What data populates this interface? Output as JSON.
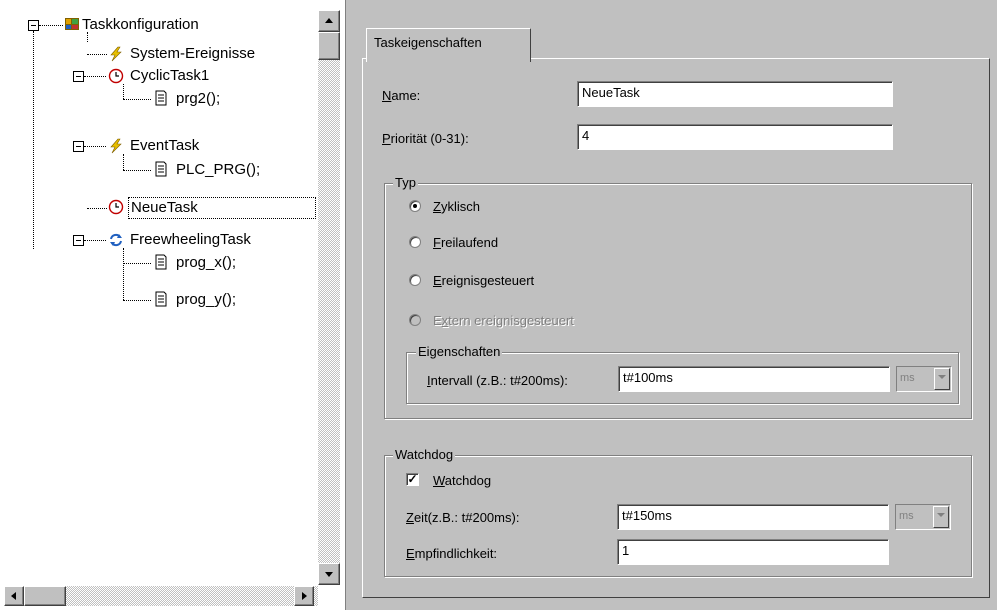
{
  "tree": {
    "root": {
      "label": "Taskkonfiguration",
      "icon": "task-config-icon"
    },
    "items": [
      {
        "label": "System-Ereignisse",
        "icon": "lightning-icon"
      },
      {
        "label": "CyclicTask1",
        "icon": "clock-icon"
      },
      {
        "label": "prg2();",
        "icon": "document-icon"
      },
      {
        "label": "EventTask",
        "icon": "lightning-icon"
      },
      {
        "label": "PLC_PRG();",
        "icon": "document-icon"
      },
      {
        "label": "NeueTask",
        "icon": "clock-icon",
        "selected": true
      },
      {
        "label": "FreewheelingTask",
        "icon": "cycle-arrows-icon"
      },
      {
        "label": "prog_x();",
        "icon": "document-icon"
      },
      {
        "label": "prog_y();",
        "icon": "document-icon"
      }
    ]
  },
  "tab": {
    "label": "Taskeigenschaften"
  },
  "form": {
    "name_label_u": "N",
    "name_label_rest": "ame:",
    "name_value": "NeueTask",
    "prio_label_u": "P",
    "prio_label_rest": "riorität (0-31):",
    "prio_value": "4"
  },
  "typ": {
    "title": "Typ",
    "options": [
      {
        "u": "Z",
        "rest": "yklisch",
        "checked": true,
        "disabled": false
      },
      {
        "u": "F",
        "rest": "reilaufend",
        "checked": false,
        "disabled": false
      },
      {
        "u": "E",
        "rest": "reignisgesteuert",
        "checked": false,
        "disabled": false
      },
      {
        "pre": "E",
        "u": "x",
        "rest": "tern ereignisgesteuert",
        "checked": false,
        "disabled": true
      }
    ],
    "props_title": "Eigenschaften",
    "interval_u": "I",
    "interval_rest": "ntervall (z.B.: t#200ms):",
    "interval_value": "t#100ms",
    "interval_unit": "ms"
  },
  "watchdog": {
    "title": "Watchdog",
    "check_u": "W",
    "check_rest": "atchdog",
    "checked": true,
    "time_u": "Z",
    "time_rest": "eit(z.B.: t#200ms):",
    "time_value": "t#150ms",
    "time_unit": "ms",
    "sens_u": "E",
    "sens_rest": "mpfindlichkeit:",
    "sens_value": "1"
  },
  "colors": {
    "panel": "#c0c0c0",
    "lightning": "#e8c000",
    "clock": "#c00000",
    "cycle": "#2060c0"
  }
}
